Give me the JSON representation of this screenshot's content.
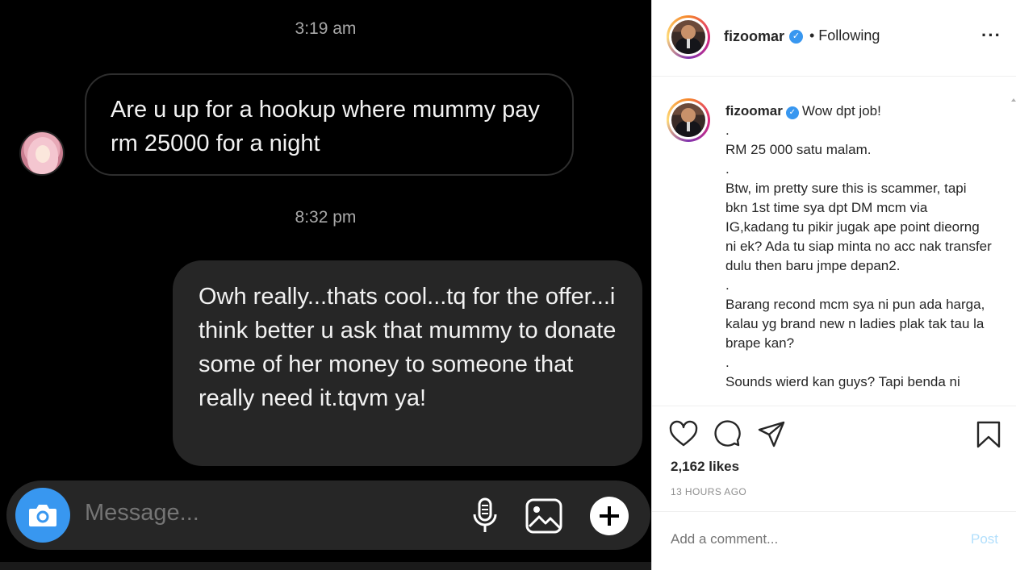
{
  "dm": {
    "timestamp_1": "3:19 am",
    "incoming_message": "Are u up for a hookup where mummy pay rm 25000 for a night",
    "timestamp_2": "8:32 pm",
    "outgoing_message": "Owh really...thats cool...tq for the offer...i think better u ask that mummy to donate some of her money to someone that really need it.tqvm ya!",
    "composer": {
      "placeholder": "Message...",
      "icons": [
        "camera-icon",
        "microphone-icon",
        "gallery-icon",
        "plus-icon"
      ]
    }
  },
  "post": {
    "header": {
      "username": "fizoomar",
      "following_label": "• Following",
      "more_icon": "more-options-icon"
    },
    "caption": {
      "username": "fizoomar",
      "lines": [
        "Wow dpt job!",
        ".",
        "RM 25 000 satu malam.",
        ".",
        "Btw, im pretty sure this is scammer, tapi bkn 1st time sya dpt DM mcm via IG,kadang tu pikir jugak ape point dieorng ni ek? Ada tu siap minta no acc nak transfer dulu then baru jmpe depan2.",
        ".",
        "Barang recond mcm sya ni pun ada harga, kalau yg brand new n ladies plak tak tau la brape kan?",
        ".",
        "Sounds wierd kan guys? Tapi benda ni"
      ]
    },
    "actions": {
      "icons": [
        "heart-icon",
        "comment-icon",
        "share-icon",
        "bookmark-icon"
      ],
      "likes": "2,162 likes",
      "time_ago": "13 HOURS AGO"
    },
    "comment_box": {
      "placeholder": "Add a comment...",
      "post_label": "Post"
    },
    "colors": {
      "accent": "#3897f0",
      "post_button_disabled": "#b2dffc",
      "dm_bubble_out": "#262626"
    }
  }
}
